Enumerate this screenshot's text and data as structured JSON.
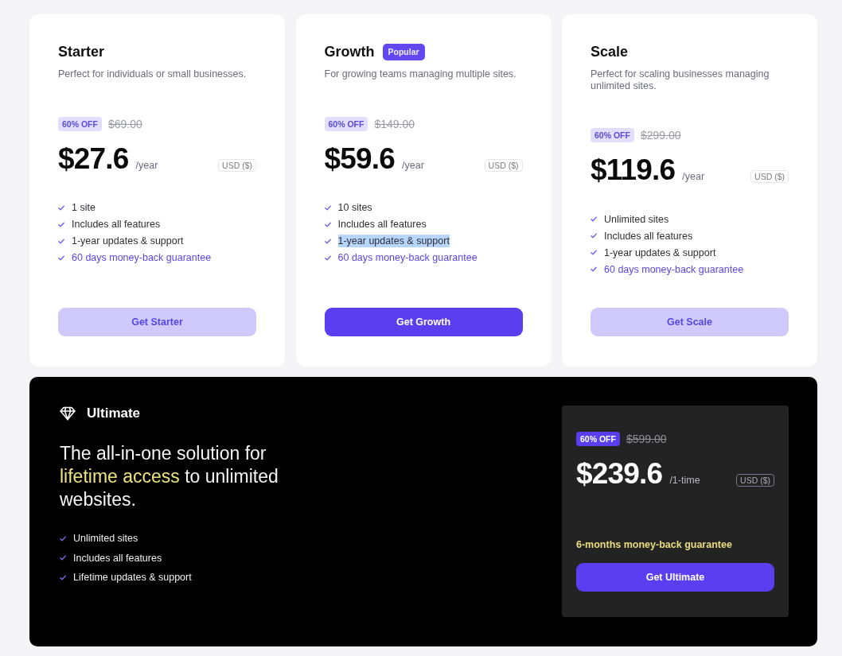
{
  "plans": [
    {
      "name": "Starter",
      "description": "Perfect for individuals or small businesses.",
      "discount": "60% OFF",
      "original_price": "$69.00",
      "price": "$27.6",
      "period": "/year",
      "currency": "USD ($)",
      "features": [
        {
          "text": "1 site",
          "kind": "feature",
          "highlighted": false
        },
        {
          "text": "Includes all features",
          "kind": "feature",
          "highlighted": false
        },
        {
          "text": "1-year updates & support",
          "kind": "feature",
          "highlighted": false
        },
        {
          "text": "60 days money-back guarantee",
          "kind": "guarantee",
          "highlighted": false
        }
      ],
      "button": {
        "label": "Get Starter",
        "kind": "soft"
      }
    },
    {
      "name": "Growth",
      "badge": "Popular",
      "description": "For growing teams managing multiple sites.",
      "discount": "60% OFF",
      "original_price": "$149.00",
      "price": "$59.6",
      "period": "/year",
      "currency": "USD ($)",
      "features": [
        {
          "text": "10 sites",
          "kind": "feature",
          "highlighted": false
        },
        {
          "text": "Includes all features",
          "kind": "feature",
          "highlighted": false
        },
        {
          "text": "1-year updates & support",
          "kind": "feature",
          "highlighted": true
        },
        {
          "text": "60 days money-back guarantee",
          "kind": "guarantee",
          "highlighted": false
        }
      ],
      "button": {
        "label": "Get Growth",
        "kind": "solid"
      }
    },
    {
      "name": "Scale",
      "description": "Perfect for scaling businesses managing unlimited sites.",
      "discount": "60% OFF",
      "original_price": "$299.00",
      "price": "$119.6",
      "period": "/year",
      "currency": "USD ($)",
      "features": [
        {
          "text": "Unlimited sites",
          "kind": "feature",
          "highlighted": false
        },
        {
          "text": "Includes all features",
          "kind": "feature",
          "highlighted": false
        },
        {
          "text": "1-year updates & support",
          "kind": "feature",
          "highlighted": false
        },
        {
          "text": "60 days money-back guarantee",
          "kind": "guarantee",
          "highlighted": false
        }
      ],
      "button": {
        "label": "Get Scale",
        "kind": "soft"
      }
    }
  ],
  "ultimate": {
    "title": "Ultimate",
    "headline": [
      {
        "text": "The all-in-one solution for ",
        "highlight": false
      },
      {
        "text": "lifetime access",
        "highlight": true
      },
      {
        "text": " to unlimited websites.",
        "highlight": false
      }
    ],
    "features": [
      "Unlimited sites",
      "Includes all features",
      "Lifetime updates & support"
    ],
    "offer": {
      "discount": "60% OFF",
      "original_price": "$599.00",
      "price": "$239.6",
      "period": "/1-time",
      "currency": "USD ($)",
      "guarantee": "6-months money-back guarantee",
      "button": {
        "label": "Get Ultimate",
        "kind": "solid"
      }
    }
  }
}
